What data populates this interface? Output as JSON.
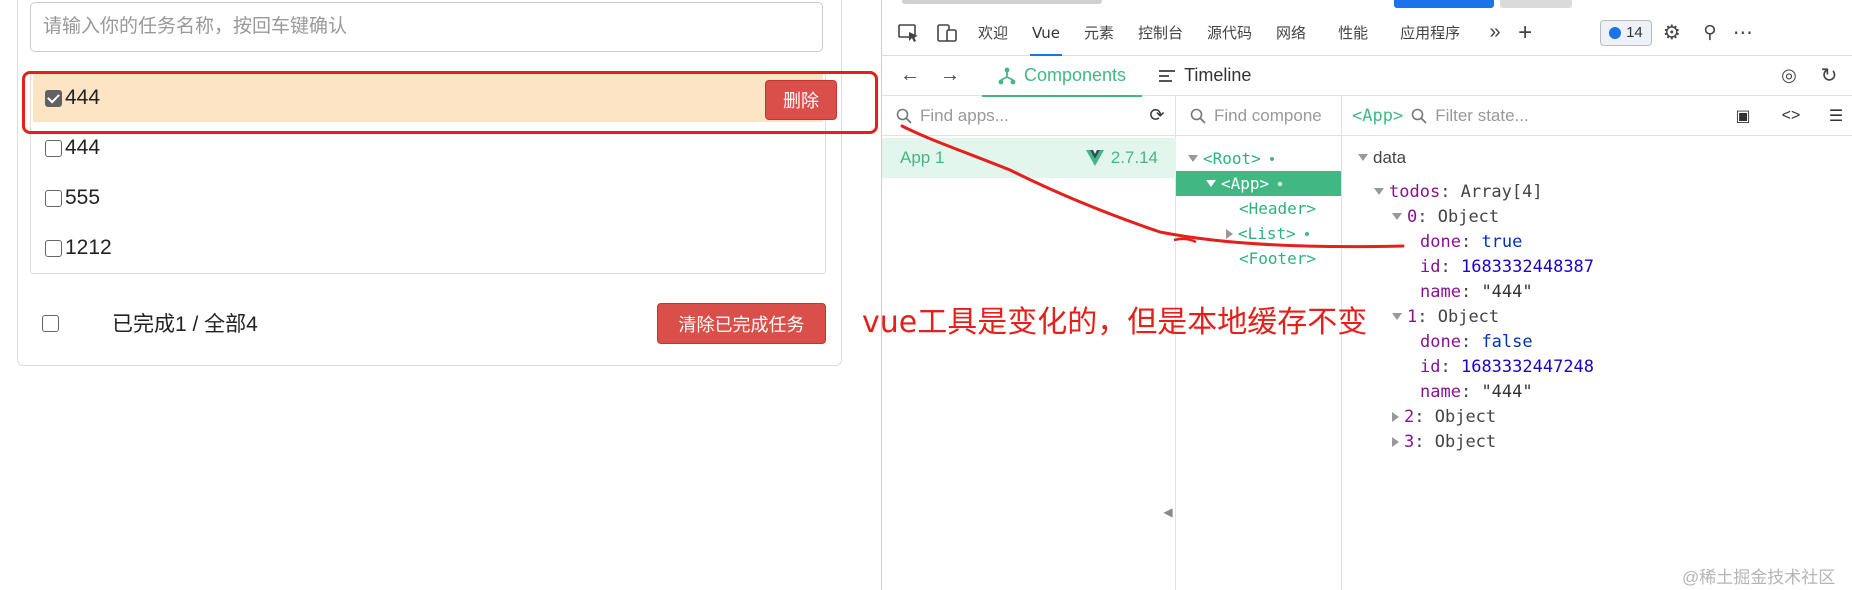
{
  "todo": {
    "input_placeholder": "请输入你的任务名称，按回车键确认",
    "items": [
      {
        "name": "444",
        "done": true,
        "delete_label": "删除"
      },
      {
        "name": "444",
        "done": false
      },
      {
        "name": "555",
        "done": false
      },
      {
        "name": "1212",
        "done": false
      }
    ],
    "footer": {
      "summary": "已完成1 / 全部4",
      "clear_label": "清除已完成任务"
    }
  },
  "devtools": {
    "tabs": [
      "欢迎",
      "Vue",
      "元素",
      "控制台",
      "源代码",
      "网络",
      "性能",
      "应用程序"
    ],
    "issues_count": "14",
    "vue_tabs": {
      "components": "Components",
      "timeline": "Timeline"
    },
    "find_apps_placeholder": "Find apps...",
    "find_component_placeholder": "Find compone",
    "filter_state_placeholder": "Filter state...",
    "selected_component": "<App>",
    "app": {
      "name": "App 1",
      "version": "2.7.14"
    },
    "tree": {
      "root": "<Root>",
      "app": "<App>",
      "header": "<Header>",
      "list": "<List>",
      "footer": "<Footer>"
    },
    "state": {
      "section": "data",
      "todos_key": "todos",
      "todos_type": "Array[4]",
      "item0_key": "0",
      "item0_type": "Object",
      "done0_key": "done",
      "done0_val": "true",
      "id0_key": "id",
      "id0_val": "1683332448387",
      "name0_key": "name",
      "name0_val": "\"444\"",
      "item1_key": "1",
      "item1_type": "Object",
      "done1_key": "done",
      "done1_val": "false",
      "id1_key": "id",
      "id1_val": "1683332447248",
      "name1_key": "name",
      "name1_val": "\"444\"",
      "item2_key": "2",
      "item2_type": "Object",
      "item3_key": "3",
      "item3_type": "Object"
    }
  },
  "annotation": "vue工具是变化的，但是本地缓存不变",
  "watermark": "@稀土掘金技术社区",
  "colors": {
    "annotation": "#e3201b",
    "vue_green": "#41b883",
    "danger": "#da4f49",
    "hover_row": "#fde4c4"
  }
}
